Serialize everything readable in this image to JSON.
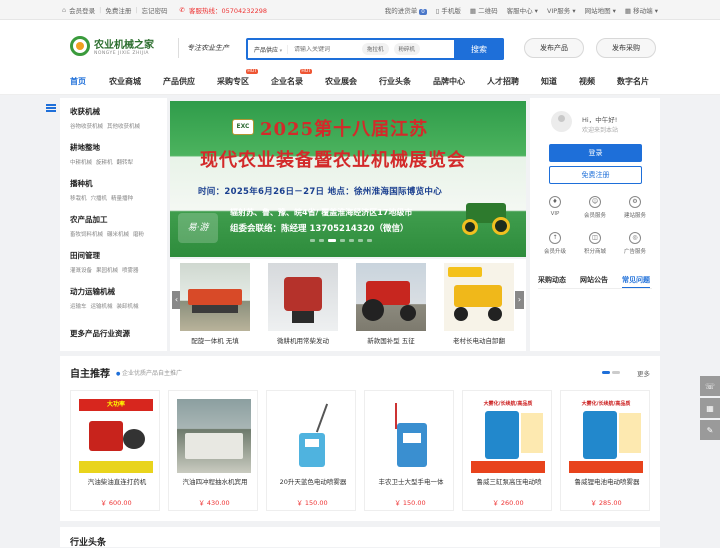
{
  "topbar": {
    "login": "会员登录",
    "register": "免费注册",
    "forgot": "忘记密码",
    "hotline": "客服热线：05704232298",
    "inquiry": "我的进货单",
    "inquiry_count": "0",
    "mobile": "手机版",
    "qrcode": "二维码",
    "service": "客服中心",
    "vip": "VIP服务",
    "sitemap": "网站地图",
    "mobile_nav": "移动端"
  },
  "header": {
    "logo_title": "农业机械之家",
    "logo_sub": "NONGYE JIXIE ZHIJIA",
    "slogan": "专注农业生产",
    "search_category": "产品供应",
    "search_placeholder": "请输入关键词",
    "search_tags": [
      "拖拉机",
      "粉碎机"
    ],
    "search_button": "搜索",
    "publish_product": "发布产品",
    "publish_purchase": "发布采购"
  },
  "nav": {
    "items": [
      "首页",
      "农业商城",
      "产品供应",
      "采购专区",
      "企业名录",
      "农业展会",
      "行业头条",
      "品牌中心",
      "人才招聘",
      "知道",
      "视频",
      "数字名片"
    ],
    "hot_label": "HOT"
  },
  "categories": [
    {
      "title": "收获机械",
      "subs": [
        "谷物收获机械",
        "其他收获机械"
      ]
    },
    {
      "title": "耕地整地",
      "subs": [
        "中耕机械",
        "旋耕机",
        "翻转犁"
      ]
    },
    {
      "title": "播种机",
      "subs": [
        "移栽机",
        "穴播机",
        "精量播种"
      ]
    },
    {
      "title": "农产品加工",
      "subs": [
        "畜牧饲料机械",
        "碾米机械",
        "磨粉"
      ]
    },
    {
      "title": "田间管理",
      "subs": [
        "灌溉设备",
        "果园机械",
        "喷雾器"
      ]
    },
    {
      "title": "动力运输机械",
      "subs": [
        "运输车",
        "运输机械",
        "装卸机械"
      ]
    },
    {
      "title": "更多产品行业资源",
      "subs": []
    }
  ],
  "banner": {
    "badge": "EXC",
    "title1": "2025第十八届江苏",
    "title2": "现代农业装备暨农业机械展览会",
    "info": "时间：2025年6月26日－27日      地点：徐州淮海国际博览中心",
    "strip": "辐射苏、鲁、豫、皖4省/ 覆盖淮海经济区17地级市",
    "contact": "组委会联络：陈经理  13705214320（微信）",
    "logo2": "易·游"
  },
  "carousel": {
    "items": [
      "配旋一体机 无填",
      "微耕机用常柴发动",
      "新款国补型 五征",
      "老村长电动自卸翻"
    ]
  },
  "panel": {
    "greeting": "Hi，中午好!",
    "welcome": "欢迎来到本站",
    "login_button": "登录",
    "register_button": "免费注册",
    "services": [
      {
        "icon": "vip-icon",
        "label": "VIP"
      },
      {
        "icon": "member-service-icon",
        "label": "会员服务"
      },
      {
        "icon": "site-service-icon",
        "label": "建站服务"
      },
      {
        "icon": "member-upgrade-icon",
        "label": "会员升级"
      },
      {
        "icon": "points-mall-icon",
        "label": "积分商城"
      },
      {
        "icon": "ad-service-icon",
        "label": "广告服务"
      }
    ],
    "tabs": [
      "采购动态",
      "网站公告",
      "常见问题"
    ]
  },
  "recommend": {
    "title": "自主推荐",
    "subtitle": "企业优质产品自主推广",
    "more": "更多",
    "products": [
      {
        "name": "汽油柴油直连打药机",
        "price": "￥ 600.00"
      },
      {
        "name": "汽油四冲程抽水机宾用",
        "price": "￥ 430.00"
      },
      {
        "name": "20升天蓝色电动喷雾器",
        "price": "￥ 150.00"
      },
      {
        "name": "丰农卫士大型手电一体",
        "price": "￥ 150.00"
      },
      {
        "name": "鲁威三缸泵高压电动喷",
        "price": "￥ 260.00"
      },
      {
        "name": "鲁威锂电池电动喷雾器",
        "price": "￥ 285.00"
      }
    ]
  },
  "bottom": {
    "title": "行业头条"
  },
  "colors": {
    "brand_blue": "#1e6fd9",
    "price_red": "#e33333",
    "logo_green": "#3a9b3c",
    "banner_red": "#d32a2a"
  }
}
